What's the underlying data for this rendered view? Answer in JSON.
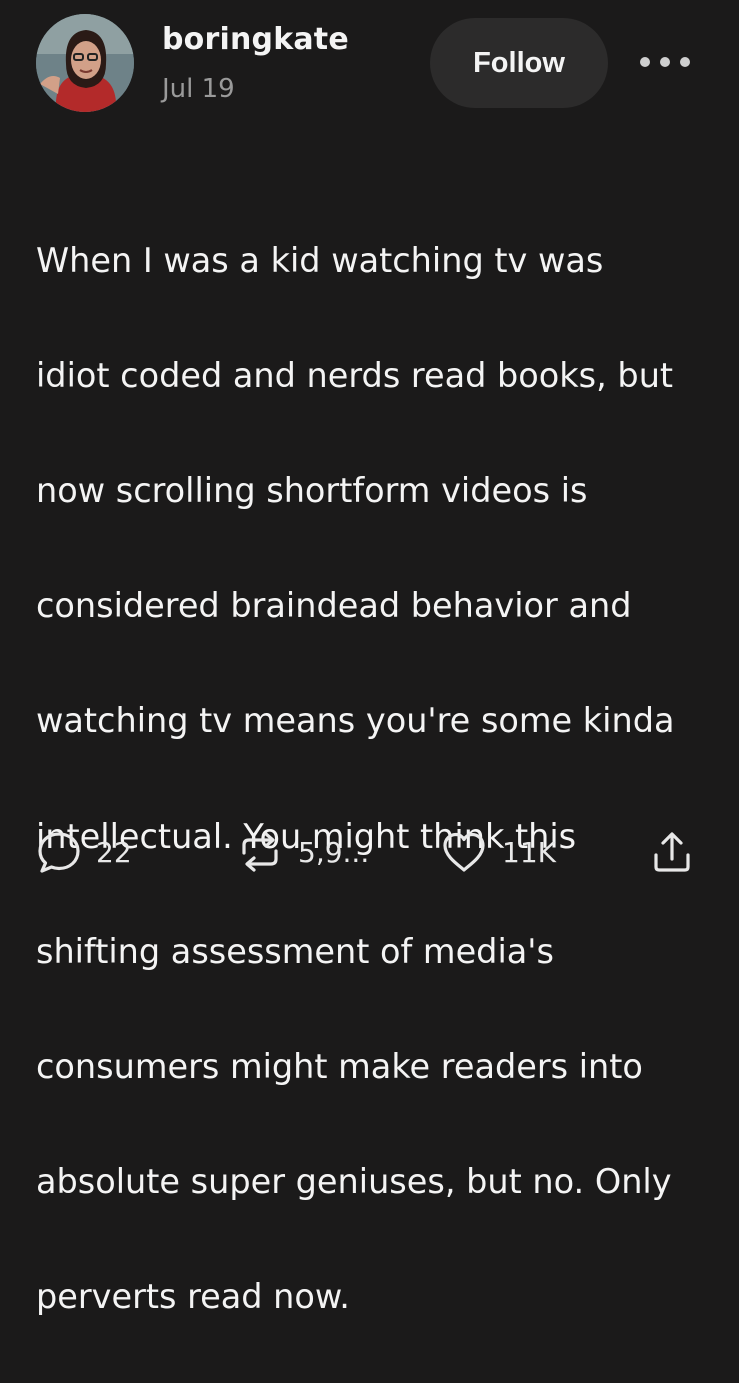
{
  "post": {
    "author": {
      "username": "boringkate",
      "date": "Jul 19"
    },
    "follow_label": "Follow",
    "more_label": "More options",
    "body_lines": [
      "When I was a kid watching tv was",
      "idiot coded and nerds read books, but",
      "now scrolling shortform videos is",
      "considered braindead behavior and",
      "watching tv means you're some kinda",
      "intellectual. You might think this",
      "shifting assessment of media's",
      "consumers might make readers into",
      "absolute super geniuses, but no. Only",
      "perverts read now."
    ],
    "actions": {
      "replies": "22",
      "reblogs": "5,9...",
      "likes": "11K"
    }
  },
  "icons": {
    "reply": "speech-bubble-icon",
    "reblog": "repost-arrows-icon",
    "like": "heart-icon",
    "share": "share-upload-icon",
    "more": "ellipsis-icon"
  },
  "colors": {
    "background": "#1b1a1a",
    "text": "#f4f4f4",
    "muted": "#9a9a9a",
    "button": "#2c2b2b"
  }
}
